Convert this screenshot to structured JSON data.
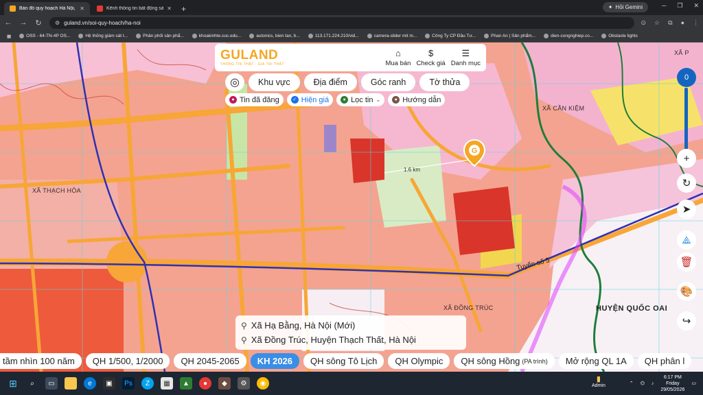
{
  "browser": {
    "tabs": [
      {
        "title": "Bản đồ quy hoạch Hà Nội, tra c",
        "active": true,
        "fav_color": "#f5a623"
      },
      {
        "title": "Kênh thông tin bất động sản",
        "active": false,
        "fav_color": "#e53935"
      }
    ],
    "gemini_label": "Hỏi Gemini",
    "url": "guland.vn/soi-quy-hoach/ha-noi",
    "bookmarks": [
      "OSS - 64-TN-4P OS...",
      "Hệ thống giám sát t...",
      "Phân phối sản phẩ...",
      "khoakinhte.cuc.edu...",
      "autonics, bien tan, b...",
      "113.171.224.210/vid...",
      "camera-slider mit m...",
      "Công Ty CP Đầu Tư...",
      "Phan An | Sản phẩm...",
      "dien-congnghiep.co...",
      "Obstacle lights"
    ]
  },
  "guland": {
    "logo": "GULAND",
    "tagline": "THÔNG TIN THẬT - GIÁ TRỊ THẬT",
    "nav": [
      {
        "label": "Mua bán",
        "icon": "house-icon"
      },
      {
        "label": "Check giá",
        "icon": "dollar-icon"
      },
      {
        "label": "Danh mục",
        "icon": "menu-icon"
      }
    ],
    "search_chips": [
      "Khu vực",
      "Địa điểm",
      "Góc ranh",
      "Tờ thửa"
    ],
    "filter_chips": [
      {
        "label": "Tin đã đăng",
        "color": "#c2185b"
      },
      {
        "label": "Hiện giá",
        "color": "#1a73e8"
      },
      {
        "label": "Lọc tin",
        "color": "#2e7d32"
      },
      {
        "label": "Hướng dẫn",
        "color": "#795548"
      }
    ]
  },
  "map": {
    "labels": {
      "xa_thach_hoa": "XÃ THẠCH HÒA",
      "xa_can_kiem": "XÃ CẦN KIỆM",
      "xa_dong_truc": "XÃ ĐỒNG TRÚC",
      "huyen_quoc_oai": "HUYỆN QUỐC OAI",
      "tuyen_so_5": "Tuyến số 5",
      "distance": "1.6 km",
      "xa_top_right": "XÃ P"
    },
    "zoom_level": "0"
  },
  "location": {
    "line1": "Xã Hạ Bằng, Hà Nội (Mới)",
    "line2": "Xã Đồng Trúc, Huyện Thạch Thất, Hà Nội"
  },
  "plan_tabs": [
    {
      "label": "tầm nhìn 100 năm"
    },
    {
      "label": "QH 1/500, 1/2000"
    },
    {
      "label": "QH 2045-2065"
    },
    {
      "label": "KH 2026",
      "active": true
    },
    {
      "label": "QH sông Tô Lịch"
    },
    {
      "label": "QH Olympic"
    },
    {
      "label": "QH sông Hồng",
      "note": "(PA trình)"
    },
    {
      "label": "Mở rộng QL 1A"
    },
    {
      "label": "QH phân l"
    }
  ],
  "taskbar": {
    "time": "6:17 PM",
    "day": "Friday",
    "date": "29/05/2026",
    "admin": "Admin"
  }
}
